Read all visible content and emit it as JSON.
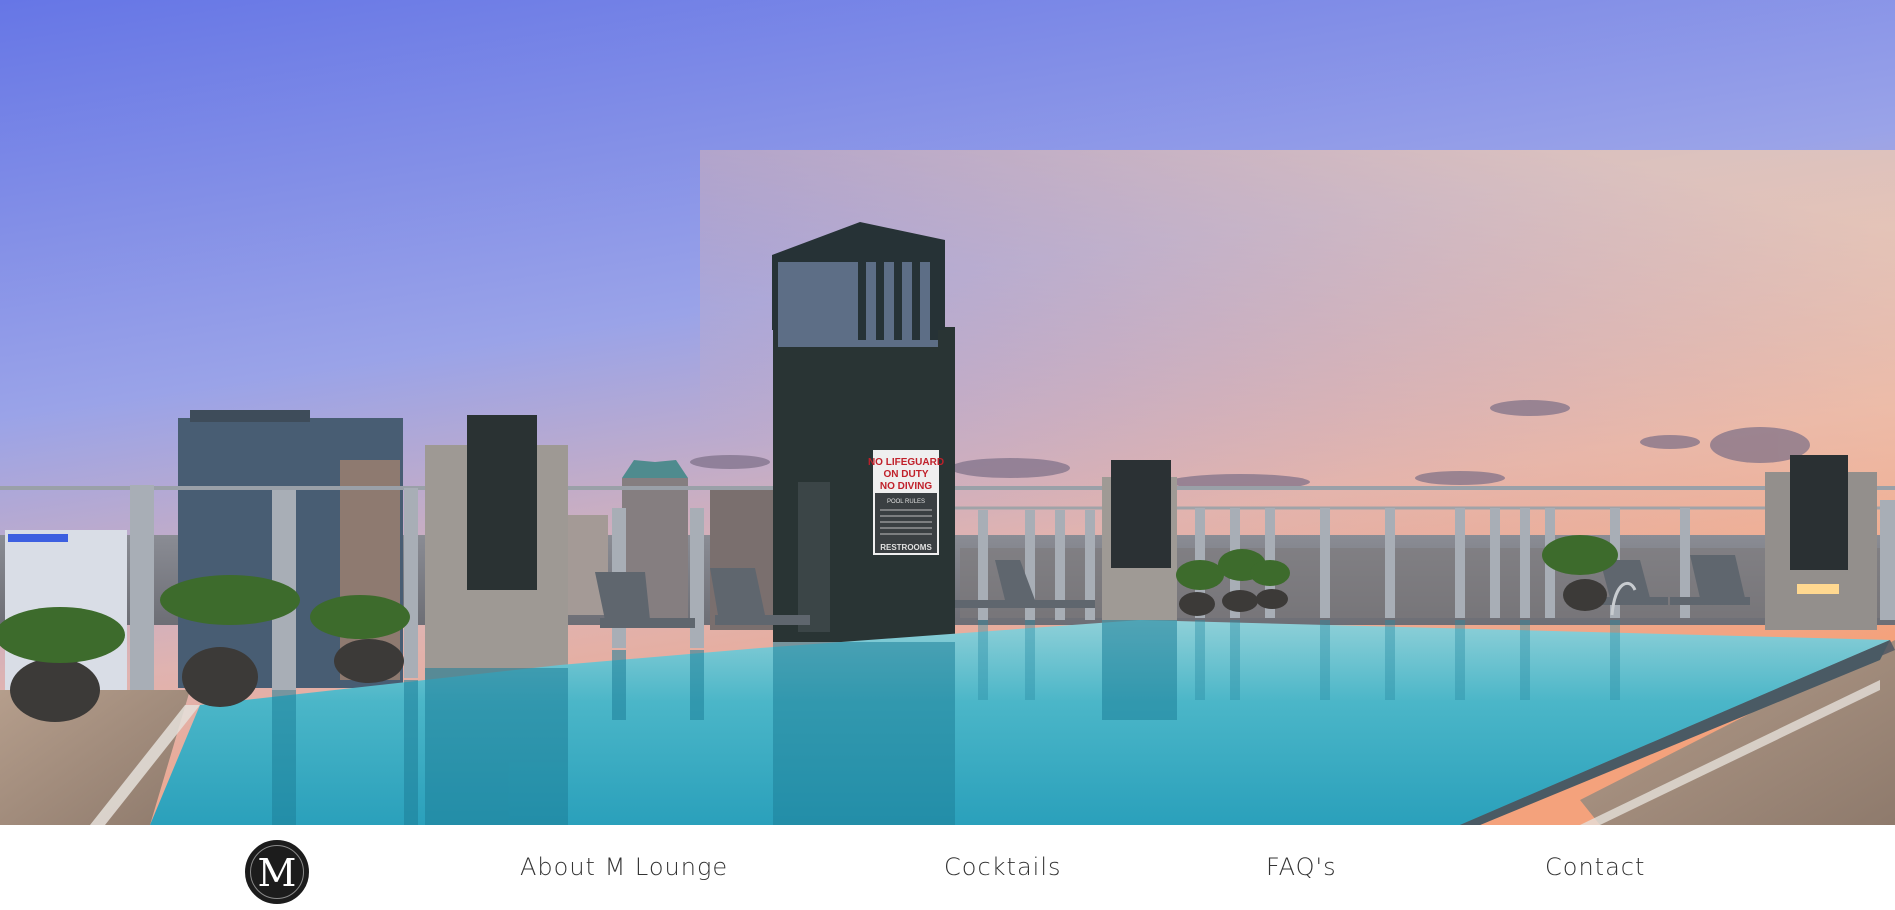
{
  "hero": {
    "sign_line_1": "NO LIFEGUARD",
    "sign_line_2": "ON DUTY",
    "sign_line_3": "NO DIVING",
    "sign_rules_title": "POOL RULES",
    "sign_footer": "RESTROOMS"
  },
  "nav": {
    "logo_letter": "M",
    "items": [
      {
        "label": "About M Lounge"
      },
      {
        "label": "Cocktails"
      },
      {
        "label": "FAQ's"
      },
      {
        "label": "Contact"
      }
    ]
  },
  "colors": {
    "sky_top": "#6f7fea",
    "sky_horizon": "#f3b08a",
    "pool_water": "#3fb4c8",
    "nav_text": "#333333",
    "logo_bg": "#1c1c1c"
  }
}
